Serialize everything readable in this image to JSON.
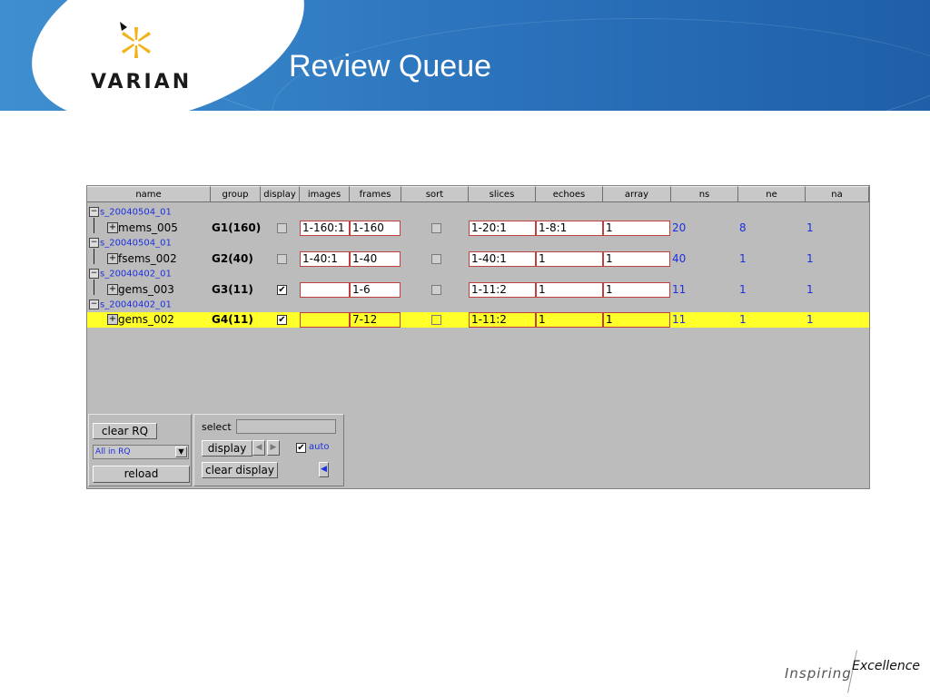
{
  "brand": {
    "logo_text": "VARIAN",
    "colors": {
      "banner": "#2a72bb",
      "accent": "#1c2fe0",
      "selection": "#ffff2a"
    }
  },
  "slide": {
    "title": "Review Queue"
  },
  "table": {
    "columns": [
      "name",
      "group",
      "display",
      "images",
      "frames",
      "sort",
      "slices",
      "echoes",
      "array",
      "ns",
      "ne",
      "na"
    ],
    "sessions": [
      {
        "session": "s_20040504_01",
        "name": "mems_005",
        "group": "G1(160)",
        "display": false,
        "images": "1-160:1",
        "frames": "1-160",
        "sort": false,
        "slices": "1-20:1",
        "echoes": "1-8:1",
        "array": "1",
        "ns": "20",
        "ne": "8",
        "na": "1",
        "selected": false
      },
      {
        "session": "s_20040504_01",
        "name": "fsems_002",
        "group": "G2(40)",
        "display": false,
        "images": "1-40:1",
        "frames": "1-40",
        "sort": false,
        "slices": "1-40:1",
        "echoes": "1",
        "array": "1",
        "ns": "40",
        "ne": "1",
        "na": "1",
        "selected": false
      },
      {
        "session": "s_20040402_01",
        "name": "gems_003",
        "group": "G3(11)",
        "display": true,
        "images": "",
        "frames": "1-6",
        "sort": false,
        "slices": "1-11:2",
        "echoes": "1",
        "array": "1",
        "ns": "11",
        "ne": "1",
        "na": "1",
        "selected": false
      },
      {
        "session": "s_20040402_01",
        "name": "gems_002",
        "group": "G4(11)",
        "display": true,
        "images": "",
        "frames": "7-12",
        "sort": false,
        "slices": "1-11:2",
        "echoes": "1",
        "array": "1",
        "ns": "11",
        "ne": "1",
        "na": "1",
        "selected": true
      }
    ]
  },
  "controls": {
    "clear_rq": "clear RQ",
    "filter_value": "All in RQ",
    "reload": "reload",
    "select_label": "select",
    "select_value": "",
    "display": "display",
    "auto_label": "auto",
    "auto_checked": true,
    "clear_display": "clear display"
  },
  "footer": {
    "tagline_1": "Inspiring",
    "tagline_2": "Excellence"
  },
  "icons": [
    "varian-logo-icon",
    "tree-collapse-icon",
    "tree-expand-icon",
    "checkbox-icon",
    "dropdown-arrow-icon",
    "arrow-left-icon",
    "arrow-right-icon"
  ]
}
